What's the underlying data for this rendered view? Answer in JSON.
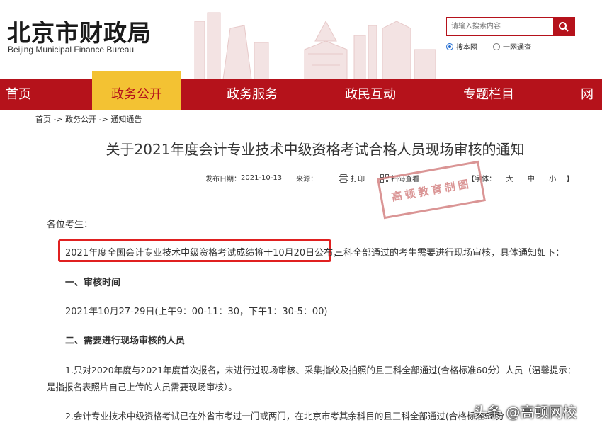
{
  "header": {
    "logo_cn": "北京市财政局",
    "logo_en": "Beijing Municipal Finance Bureau",
    "search_placeholder": "请输入搜索内容",
    "scope_site": "搜本网",
    "scope_network": "一网通查"
  },
  "nav": {
    "items": [
      "首页",
      "政务公开",
      "政务服务",
      "政民互动",
      "专题栏目",
      "网站"
    ]
  },
  "breadcrumb": "首页 -> 政务公开 -> 通知通告",
  "article": {
    "title": "关于2021年度会计专业技术中级资格考试合格人员现场审核的通知",
    "publish_label": "发布日期：",
    "publish_date": "2021-10-13",
    "source_label": "来源：",
    "print_label": "打印",
    "scan_label": "扫码查看",
    "font_label": "【字体：",
    "font_large": "大",
    "font_medium": "中",
    "font_small": "小",
    "font_end": "】",
    "stamp_text": "高顿教育制图",
    "greeting": "各位考生：",
    "highlight_text": "2021年度全国会计专业技术中级资格考试成绩将于10月20日公布，",
    "highlight_rest": "三科全部通过的考生需要进行现场审核，具体通知如下：",
    "section1": "一、审核时间",
    "time_text": "2021年10月27-29日(上午9：00-11：30，下午1：30-5：00)",
    "section2": "二、需要进行现场审核的人员",
    "item1_line1": "1.只对2020年度与2021年度首次报名，未进行过现场审核、采集指纹及拍照的且三科全部通过(合格标准60分）人员（温馨提示：",
    "item1_line2": "是指报名表照片自己上传的人员需要现场审核）。",
    "item2_line1": "2.会计专业技术中级资格考试已在外省市考过一门或两门，在北京市考其余科目的且三科全部通过(合格标准60分"
  },
  "watermark": "头条 @高顿网校",
  "colors": {
    "brand_red": "#b5121b",
    "nav_active": "#f3c233",
    "highlight_border": "#e02020"
  }
}
